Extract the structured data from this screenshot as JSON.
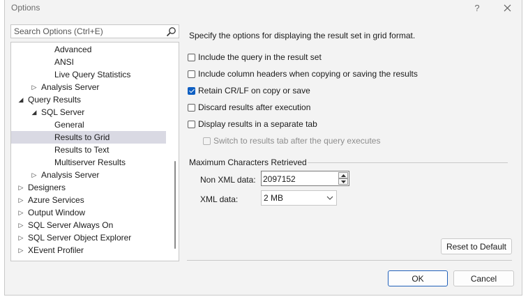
{
  "window": {
    "title": "Options",
    "help_glyph": "?",
    "close_glyph": "✕"
  },
  "search": {
    "placeholder": "Search Options (Ctrl+E)",
    "value": ""
  },
  "tree": {
    "items": [
      {
        "label": "Advanced",
        "arrow": "",
        "level": 3,
        "selected": false
      },
      {
        "label": "ANSI",
        "arrow": "",
        "level": 3,
        "selected": false
      },
      {
        "label": "Live Query Statistics",
        "arrow": "",
        "level": 3,
        "selected": false
      },
      {
        "label": "Analysis Server",
        "arrow": "▷",
        "level": 2,
        "selected": false
      },
      {
        "label": "Query Results",
        "arrow": "◢",
        "level": 1,
        "selected": false
      },
      {
        "label": "SQL Server",
        "arrow": "◢",
        "level": 2,
        "selected": false
      },
      {
        "label": "General",
        "arrow": "",
        "level": 3,
        "selected": false
      },
      {
        "label": "Results to Grid",
        "arrow": "",
        "level": 3,
        "selected": true
      },
      {
        "label": "Results to Text",
        "arrow": "",
        "level": 3,
        "selected": false
      },
      {
        "label": "Multiserver Results",
        "arrow": "",
        "level": 3,
        "selected": false
      },
      {
        "label": "Analysis Server",
        "arrow": "▷",
        "level": 2,
        "selected": false
      },
      {
        "label": "Designers",
        "arrow": "▷",
        "level": 1,
        "selected": false
      },
      {
        "label": "Azure Services",
        "arrow": "▷",
        "level": 1,
        "selected": false
      },
      {
        "label": "Output Window",
        "arrow": "▷",
        "level": 1,
        "selected": false
      },
      {
        "label": "SQL Server Always On",
        "arrow": "▷",
        "level": 1,
        "selected": false
      },
      {
        "label": "SQL Server Object Explorer",
        "arrow": "▷",
        "level": 1,
        "selected": false
      },
      {
        "label": "XEvent Profiler",
        "arrow": "▷",
        "level": 1,
        "selected": false
      }
    ]
  },
  "panel": {
    "description": "Specify the options for displaying the result set in grid format.",
    "options": [
      {
        "label": "Include the query in the result set",
        "checked": false,
        "disabled": false
      },
      {
        "label": "Include column headers when copying or saving the results",
        "checked": false,
        "disabled": false
      },
      {
        "label": "Retain CR/LF on copy or save",
        "checked": true,
        "disabled": false
      },
      {
        "label": "Discard results after execution",
        "checked": false,
        "disabled": false
      },
      {
        "label": "Display results in a separate tab",
        "checked": false,
        "disabled": false
      },
      {
        "label": "Switch to results tab after the query executes",
        "checked": false,
        "disabled": true
      }
    ],
    "max_chars_group": "Maximum Characters Retrieved",
    "non_xml_label": "Non XML data:",
    "non_xml_value": "2097152",
    "xml_label": "XML data:",
    "xml_value": "2 MB"
  },
  "buttons": {
    "reset": "Reset to Default",
    "ok": "OK",
    "cancel": "Cancel"
  },
  "colors": {
    "accent": "#0f5fc2",
    "selection": "#d9d9e3"
  }
}
